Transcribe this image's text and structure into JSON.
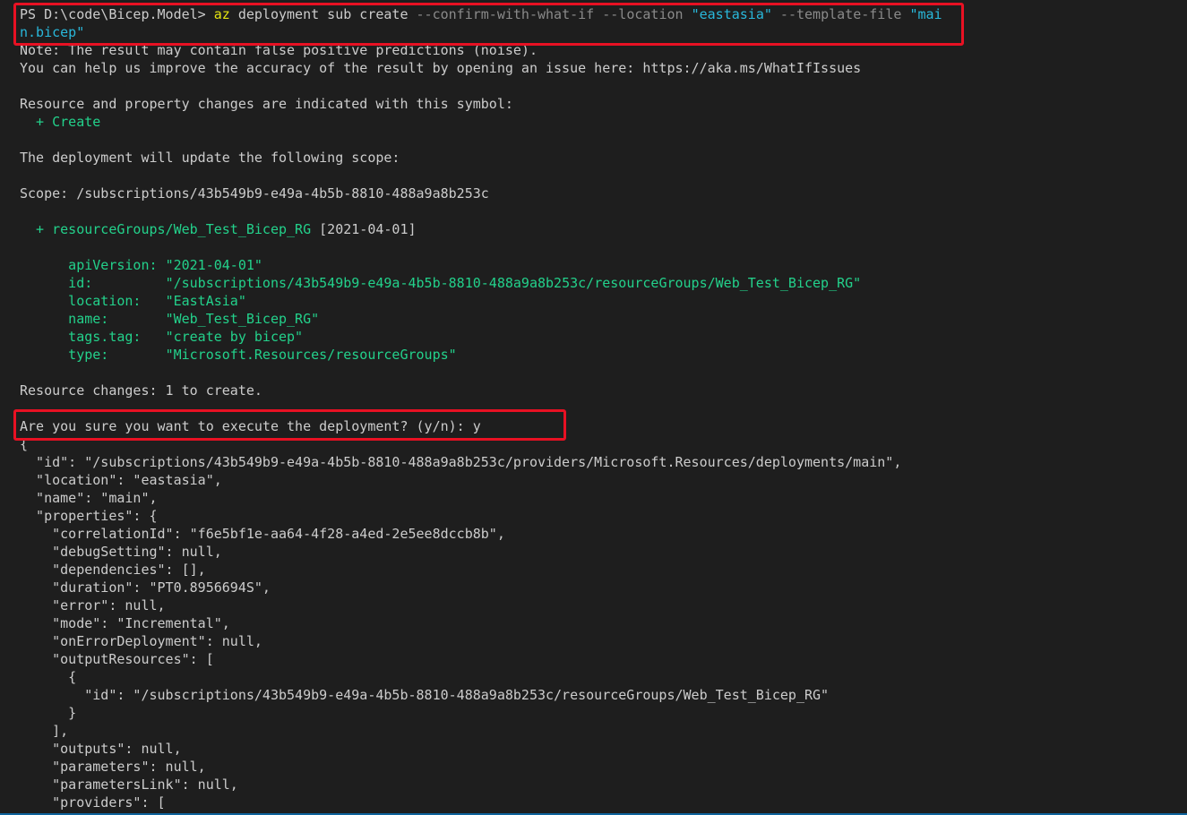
{
  "command": {
    "prompt": "PS D:\\code\\Bicep.Model> ",
    "az": "az",
    "sub": " deployment sub create ",
    "flag_confirm": "--confirm-with-what-if",
    "flag_location": " --location ",
    "location_value": "\"eastasia\"",
    "flag_template": " --template-file ",
    "template_value_part1": "\"mai",
    "template_value_part2": "n.bicep\""
  },
  "notes": {
    "noise": "Note: The result may contain false positive predictions (noise).",
    "help": "You can help us improve the accuracy of the result by opening an issue here: https://aka.ms/WhatIfIssues"
  },
  "legend": {
    "heading": "Resource and property changes are indicated with this symbol:",
    "create_symbol": "  + Create"
  },
  "scope": {
    "update_text": "The deployment will update the following scope:",
    "scope_line": "Scope: /subscriptions/43b549b9-e49a-4b5b-8810-488a9a8b253c"
  },
  "resource": {
    "header": "  + resourceGroups/Web_Test_Bicep_RG",
    "api_tag": " [2021-04-01]",
    "properties": [
      {
        "key": "      apiVersion: ",
        "value": "\"2021-04-01\""
      },
      {
        "key": "      id:         ",
        "value": "\"/subscriptions/43b549b9-e49a-4b5b-8810-488a9a8b253c/resourceGroups/Web_Test_Bicep_RG\""
      },
      {
        "key": "      location:   ",
        "value": "\"EastAsia\""
      },
      {
        "key": "      name:       ",
        "value": "\"Web_Test_Bicep_RG\""
      },
      {
        "key": "      tags.tag:   ",
        "value": "\"create by bicep\""
      },
      {
        "key": "      type:       ",
        "value": "\"Microsoft.Resources/resourceGroups\""
      }
    ]
  },
  "summary": "Resource changes: 1 to create.",
  "confirm_prompt": "Are you sure you want to execute the deployment? (y/n): y",
  "json_output": [
    "{",
    "  \"id\": \"/subscriptions/43b549b9-e49a-4b5b-8810-488a9a8b253c/providers/Microsoft.Resources/deployments/main\",",
    "  \"location\": \"eastasia\",",
    "  \"name\": \"main\",",
    "  \"properties\": {",
    "    \"correlationId\": \"f6e5bf1e-aa64-4f28-a4ed-2e5ee8dccb8b\",",
    "    \"debugSetting\": null,",
    "    \"dependencies\": [],",
    "    \"duration\": \"PT0.8956694S\",",
    "    \"error\": null,",
    "    \"mode\": \"Incremental\",",
    "    \"onErrorDeployment\": null,",
    "    \"outputResources\": [",
    "      {",
    "        \"id\": \"/subscriptions/43b549b9-e49a-4b5b-8810-488a9a8b253c/resourceGroups/Web_Test_Bicep_RG\"",
    "      }",
    "    ],",
    "    \"outputs\": null,",
    "    \"parameters\": null,",
    "    \"parametersLink\": null,",
    "    \"providers\": ["
  ],
  "colors": {
    "background": "#1e1e1e",
    "text": "#cccccc",
    "green": "#23d18b",
    "yellow": "#e5e510",
    "cyan": "#29b8db",
    "dim": "#8a8a8a",
    "highlight": "#e81123"
  }
}
